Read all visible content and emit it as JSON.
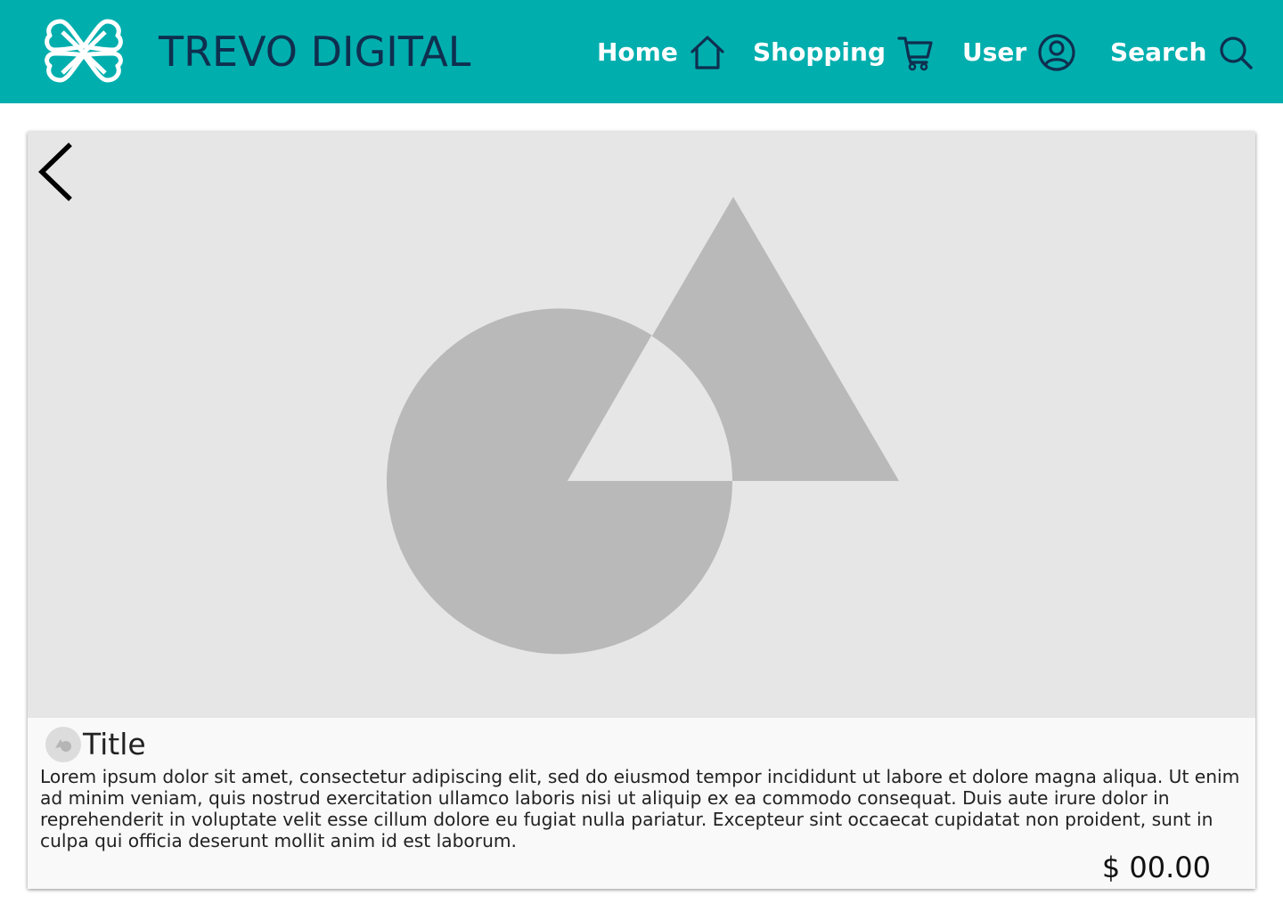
{
  "header": {
    "brand": "TREVO DIGITAL",
    "logo_icon": "clover-logo-icon",
    "accent_color": "#00aeae",
    "brand_color": "#0f2f4f",
    "nav": [
      {
        "label": "Home",
        "icon": "home-icon"
      },
      {
        "label": "Shopping",
        "icon": "cart-icon"
      },
      {
        "label": "User",
        "icon": "user-icon"
      },
      {
        "label": "Search",
        "icon": "search-icon"
      }
    ]
  },
  "card": {
    "media_icon": "image-placeholder-icon",
    "back_icon": "chevron-left-icon",
    "title": "Title",
    "body": "Lorem ipsum dolor sit amet, consectetur adipiscing elit, sed do eiusmod tempor incididunt ut labore et dolore magna aliqua. Ut enim ad minim veniam, quis nostrud exercitation ullamco laboris nisi ut aliquip ex ea commodo consequat. Duis aute irure dolor in reprehenderit in voluptate velit esse cillum dolore eu fugiat nulla pariatur. Excepteur sint occaecat cupidatat non proident, sunt in culpa qui officia deserunt mollit anim id est laborum.",
    "price": "$ 00.00"
  }
}
